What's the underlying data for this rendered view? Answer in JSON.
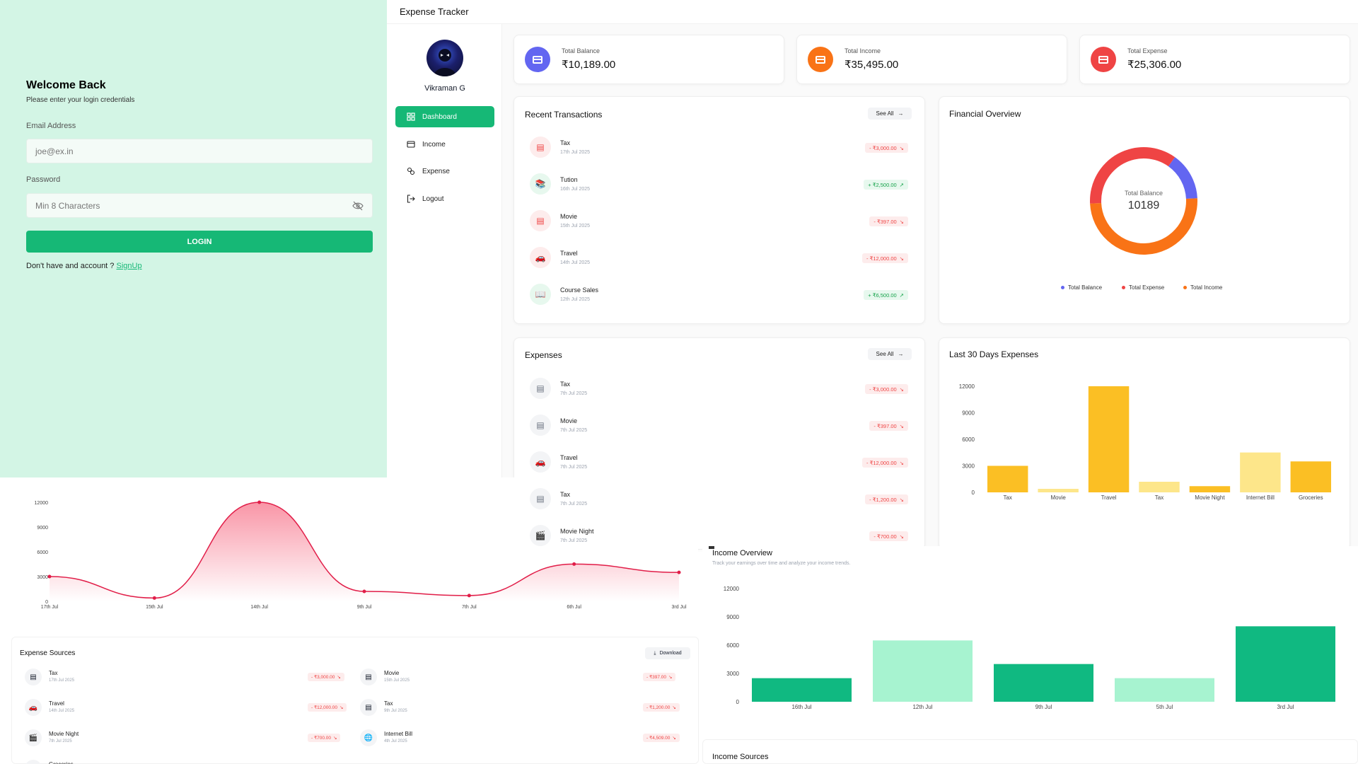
{
  "login": {
    "title": "Welcome Back",
    "subtitle": "Please enter your login credentials",
    "email_label": "Email Address",
    "email_placeholder": "joe@ex.in",
    "password_label": "Password",
    "password_placeholder": "Min 8 Characters",
    "login_button": "LOGIN",
    "signup_prompt": "Don't have and account ?",
    "signup_link": "SignUp"
  },
  "app": {
    "title": "Expense Tracker",
    "user_name": "Vikraman G",
    "nav": [
      {
        "label": "Dashboard",
        "icon": "dashboard-icon",
        "active": true
      },
      {
        "label": "Income",
        "icon": "wallet-icon",
        "active": false
      },
      {
        "label": "Expense",
        "icon": "expense-icon",
        "active": false
      },
      {
        "label": "Logout",
        "icon": "logout-icon",
        "active": false
      }
    ]
  },
  "stats": [
    {
      "label": "Total Balance",
      "value": "₹10,189.00",
      "color": "#6366f1"
    },
    {
      "label": "Total Income",
      "value": "₹35,495.00",
      "color": "#f97316"
    },
    {
      "label": "Total Expense",
      "value": "₹25,306.00",
      "color": "#ef4444"
    }
  ],
  "recent": {
    "title": "Recent Transactions",
    "see_all": "See All",
    "items": [
      {
        "name": "Tax",
        "date": "17th Jul 2025",
        "amount": "- ₹3,000.00",
        "type": "neg",
        "icon": "receipt-icon"
      },
      {
        "name": "Tution",
        "date": "16th Jul 2025",
        "amount": "+ ₹2,500.00",
        "type": "pos",
        "icon": "books-icon"
      },
      {
        "name": "Movie",
        "date": "15th Jul 2025",
        "amount": "- ₹397.00",
        "type": "neg",
        "icon": "receipt-icon"
      },
      {
        "name": "Travel",
        "date": "14th Jul 2025",
        "amount": "- ₹12,000.00",
        "type": "neg",
        "icon": "car-icon"
      },
      {
        "name": "Course Sales",
        "date": "12th Jul 2025",
        "amount": "+ ₹6,500.00",
        "type": "pos",
        "icon": "book-icon"
      }
    ]
  },
  "expenses": {
    "title": "Expenses",
    "see_all": "See All",
    "items": [
      {
        "name": "Tax",
        "date": "7th Jul 2025",
        "amount": "- ₹3,000.00",
        "icon": "receipt-icon"
      },
      {
        "name": "Movie",
        "date": "7th Jul 2025",
        "amount": "- ₹397.00",
        "icon": "receipt-icon"
      },
      {
        "name": "Travel",
        "date": "7th Jul 2025",
        "amount": "- ₹12,000.00",
        "icon": "car-icon"
      },
      {
        "name": "Tax",
        "date": "7th Jul 2025",
        "amount": "- ₹1,200.00",
        "icon": "receipt-icon"
      },
      {
        "name": "Movie Night",
        "date": "7th Jul 2025",
        "amount": "- ₹700.00",
        "icon": "clapper-icon"
      }
    ]
  },
  "overview": {
    "title": "Financial Overview",
    "center_label": "Total Balance",
    "center_value": "10189",
    "legend": [
      {
        "label": "Total Balance",
        "color": "#6366f1"
      },
      {
        "label": "Total Expense",
        "color": "#ef4444"
      },
      {
        "label": "Total Income",
        "color": "#f97316"
      }
    ]
  },
  "last30": {
    "title": "Last 30 Days Expenses"
  },
  "income_overview": {
    "title": "Income Overview",
    "subtitle": "Track your earnings over time and analyze your income trends."
  },
  "expense_sources": {
    "title": "Expense Sources",
    "download": "Download",
    "items": [
      {
        "name": "Tax",
        "date": "17th Jul 2025",
        "amount": "- ₹3,000.00",
        "icon": "receipt-icon"
      },
      {
        "name": "Movie",
        "date": "15th Jul 2025",
        "amount": "- ₹397.00",
        "icon": "receipt-icon"
      },
      {
        "name": "Travel",
        "date": "14th Jul 2025",
        "amount": "- ₹12,000.00",
        "icon": "car-icon"
      },
      {
        "name": "Tax",
        "date": "9th Jul 2025",
        "amount": "- ₹1,200.00",
        "icon": "receipt-icon"
      },
      {
        "name": "Movie Night",
        "date": "7th Jul 2025",
        "amount": "- ₹700.00",
        "icon": "clapper-icon"
      },
      {
        "name": "Internet Bill",
        "date": "4th Jul 2025",
        "amount": "- ₹4,509.00",
        "icon": "globe-icon"
      },
      {
        "name": "Groceries",
        "date": "",
        "amount": "",
        "icon": "receipt-icon"
      }
    ]
  },
  "income_sources": {
    "title": "Income Sources"
  },
  "chart_data": [
    {
      "type": "pie",
      "title": "Financial Overview",
      "categories": [
        "Total Balance",
        "Total Expense",
        "Total Income"
      ],
      "values": [
        10189,
        25306,
        35495
      ],
      "colors": [
        "#6366f1",
        "#ef4444",
        "#f97316"
      ]
    },
    {
      "type": "bar",
      "title": "Last 30 Days Expenses",
      "categories": [
        "Tax",
        "Movie",
        "Travel",
        "Tax",
        "Movie Night",
        "Internet Bill",
        "Groceries"
      ],
      "values": [
        3000,
        397,
        12000,
        1200,
        700,
        4509,
        3500
      ],
      "yticks": [
        0,
        3000,
        6000,
        9000,
        12000
      ],
      "ylim": [
        0,
        12000
      ]
    },
    {
      "type": "area",
      "categories": [
        "17th Jul",
        "15th Jul",
        "14th Jul",
        "9th Jul",
        "7th Jul",
        "6th Jul",
        "3rd Jul"
      ],
      "values": [
        3000,
        397,
        12000,
        1200,
        700,
        4509,
        3500
      ],
      "yticks": [
        0,
        3000,
        6000,
        9000,
        12000
      ],
      "ylim": [
        0,
        12000
      ]
    },
    {
      "type": "bar",
      "title": "Income Overview",
      "categories": [
        "16th Jul",
        "12th Jul",
        "9th Jul",
        "5th Jul",
        "3rd Jul"
      ],
      "values": [
        2500,
        6500,
        4000,
        2500,
        8000
      ],
      "yticks": [
        0,
        3000,
        6000,
        9000,
        12000
      ],
      "ylim": [
        0,
        12000
      ]
    }
  ]
}
